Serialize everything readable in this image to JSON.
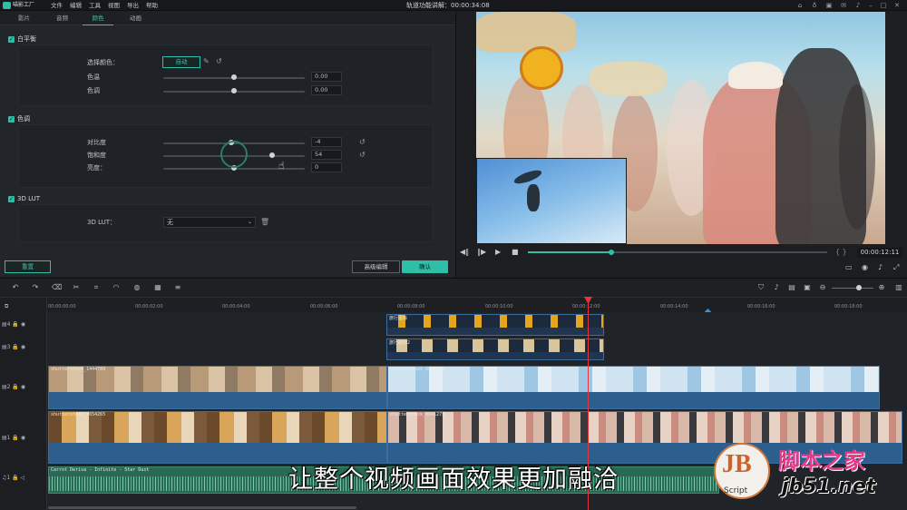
{
  "app": {
    "logo_text": "喵影工厂",
    "title": "轨道功能讲解：00:00:34:08"
  },
  "menu": [
    "文件",
    "编辑",
    "工具",
    "视图",
    "导出",
    "帮助"
  ],
  "tabs": [
    {
      "label": "影片"
    },
    {
      "label": "音频"
    },
    {
      "label": "颜色"
    },
    {
      "label": "动画"
    }
  ],
  "active_tab": "颜色",
  "white_balance": {
    "title": "白平衡",
    "select_color_label": "选择颜色：",
    "auto_label": "自动",
    "temperature_label": "色温",
    "temperature_value": "0.00",
    "temperature_level": 0.5,
    "tint_label": "色调",
    "tint_value": "0.00",
    "tint_level": 0.5
  },
  "tone": {
    "title": "色调",
    "contrast_label": "对比度",
    "contrast_value": "-4",
    "contrast_level": 0.48,
    "saturation_label": "饱和度",
    "saturation_value": "54",
    "saturation_level": 0.77,
    "brightness_label": "亮度：",
    "brightness_value": "0",
    "brightness_level": 0.5
  },
  "lut": {
    "title": "3D LUT",
    "label": "3D LUT：",
    "value": "无"
  },
  "buttons": {
    "reset": "重置",
    "advanced": "高级编辑",
    "ok": "确认"
  },
  "player": {
    "timecode": "00:00:12:11",
    "progress": 0.28
  },
  "ruler_ticks": [
    "00:00:00:00",
    "00:00:02:00",
    "00:00:04:00",
    "00:00:06:00",
    "00:00:08:00",
    "00:00:10:00",
    "00:00:12:00",
    "00:00:14:00",
    "00:00:16:00",
    "00:00:18:00"
  ],
  "track_labels": [
    "4",
    "3",
    "2",
    "1",
    "1"
  ],
  "clips": {
    "track4_label": "旅行图标",
    "track3_label": "旅行图标2",
    "track2_a": "shutterstock_1444780",
    "track2_b": "shutterstock_6843090",
    "track1_a": "shutterstock_3654265",
    "track1_b": "shutterstock_8941275",
    "audio": "Carrot Deriva - Infinite - Star Dust"
  },
  "subtitle": "让整个视频画面效果更加融洽",
  "watermark": {
    "mark": "JB",
    "script": "Script",
    "cn": "脚本之家",
    "url": "jb51.net"
  },
  "colors": {
    "accent": "#2fbfa6",
    "playhead": "#e5353c",
    "clip_blue": "#2d5f8e",
    "audio_green": "#2f8a6a"
  }
}
